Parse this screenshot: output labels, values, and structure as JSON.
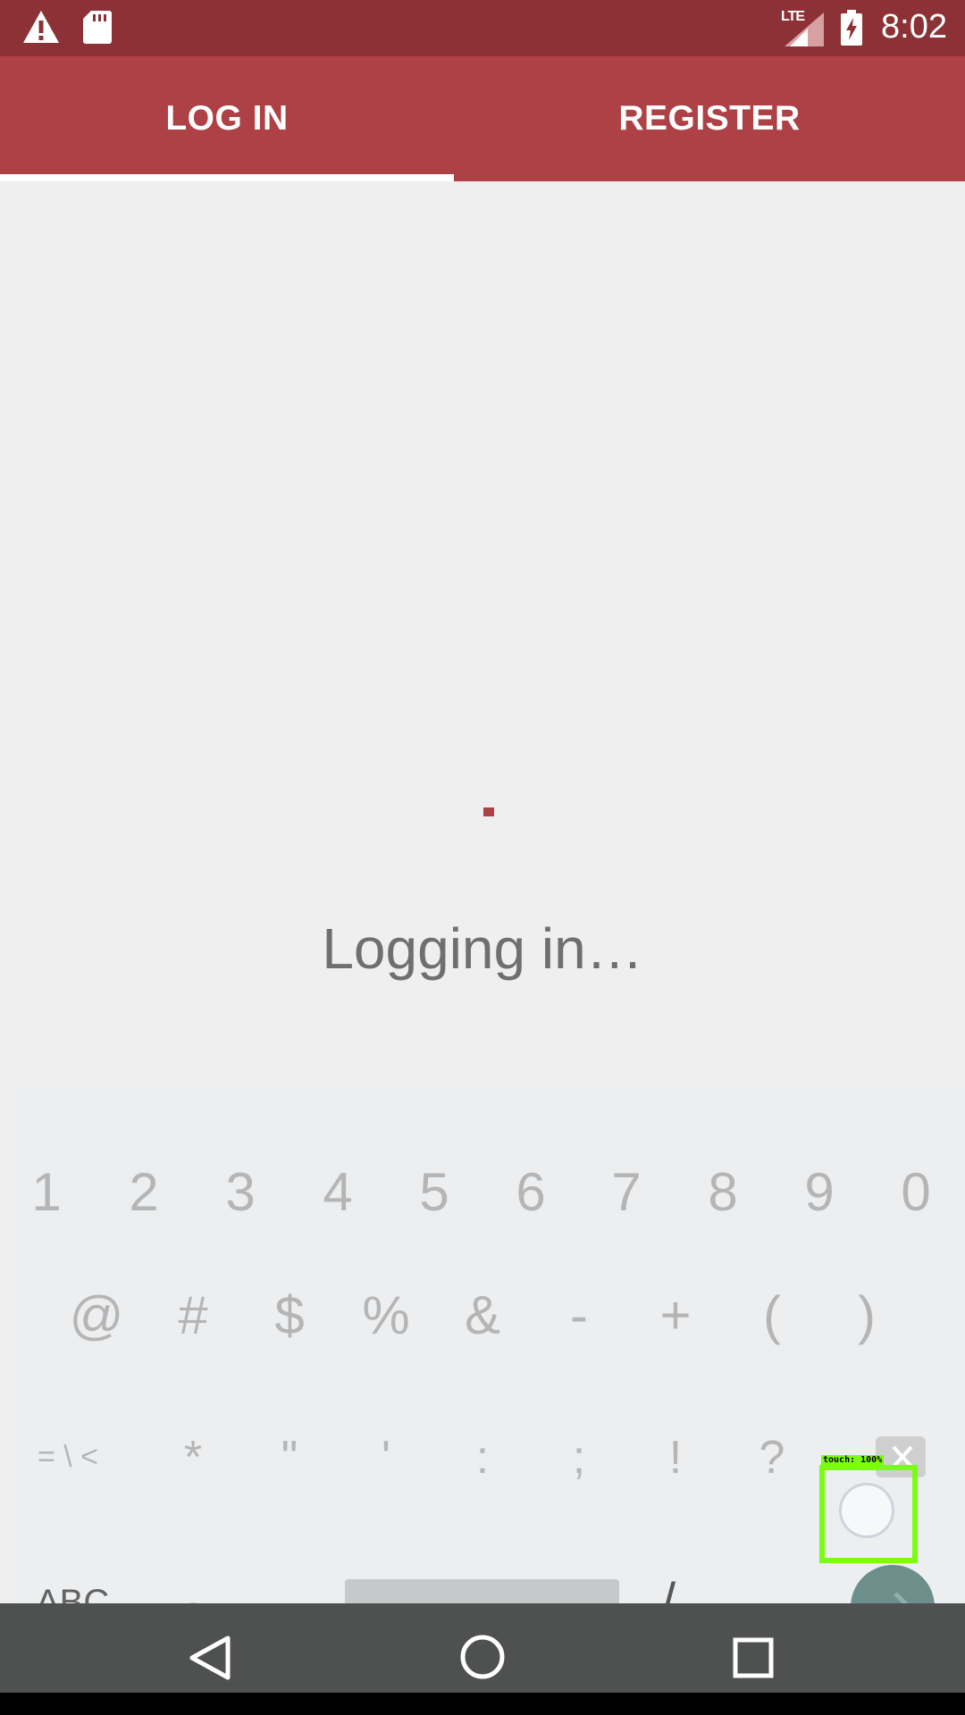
{
  "status_bar": {
    "time": "8:02",
    "network": "LTE",
    "icons": [
      "warning-icon",
      "sd-card-icon",
      "signal-icon",
      "battery-charging-icon"
    ]
  },
  "tabs": {
    "login": "LOG IN",
    "register": "REGISTER",
    "active": "login"
  },
  "main": {
    "status_text": "Logging in…"
  },
  "keyboard": {
    "row1": [
      "1",
      "2",
      "3",
      "4",
      "5",
      "6",
      "7",
      "8",
      "9",
      "0"
    ],
    "row2": [
      "@",
      "#",
      "$",
      "%",
      "&",
      "-",
      "+",
      "(",
      ")"
    ],
    "row3": [
      "= \\ <",
      "*",
      "\"",
      "'",
      ":",
      ";",
      "!",
      "?"
    ],
    "bottom": {
      "abc": "ABC",
      "comma": ",",
      "underscore": "_",
      "slash": "/",
      "period": "."
    }
  },
  "overlay": {
    "touch_label": "touch: 100%"
  },
  "colors": {
    "status_bar": "#8c3236",
    "tab_bar": "#ae4145",
    "accent": "#ae4145"
  }
}
